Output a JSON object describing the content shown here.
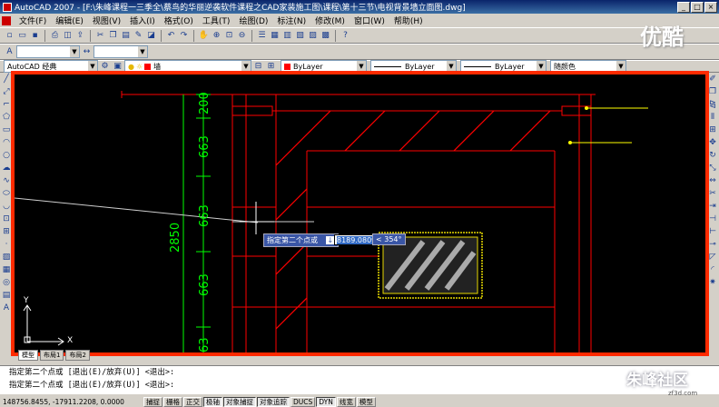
{
  "window": {
    "title": "AutoCAD 2007 - [F:\\朱峰课程一三季全\\蔡鸟的华丽逆袭软件课程之CAD家装施工图\\课程\\第十三节\\电视背景墙立面图.dwg]",
    "min": "_",
    "max": "□",
    "close": "×"
  },
  "menu": [
    "文件(F)",
    "编辑(E)",
    "视图(V)",
    "插入(I)",
    "格式(O)",
    "工具(T)",
    "绘图(D)",
    "标注(N)",
    "修改(M)",
    "窗口(W)",
    "帮助(H)"
  ],
  "toolbar": {
    "workspace": "AutoCAD 经典",
    "layer": "墙",
    "color": "ByLayer",
    "linetype": "ByLayer",
    "lineweight": "ByLayer",
    "plotstyle": "随颜色"
  },
  "drawing": {
    "dim_200": "200",
    "dim_663a": "663",
    "dim_663b": "663",
    "dim_663c": "663",
    "dim_63": "63",
    "dim_total": "2850",
    "ucs_y": "Y",
    "ucs_x": "X"
  },
  "dynamic_input": {
    "prompt": "指定第二个点或",
    "prompt_icon": "↓",
    "distance": "8189.0809",
    "angle": "< 354°"
  },
  "tabs": [
    "模型",
    "布局1",
    "布局2"
  ],
  "command": {
    "line1": "指定第二个点或 [退出(E)/放弃(U)] <退出>:",
    "line2": "指定第二个点或 [退出(E)/放弃(U)] <退出>:"
  },
  "status": {
    "coords": "148756.8455, -17911.2208, 0.0000",
    "buttons": [
      "捕捉",
      "栅格",
      "正交",
      "极轴",
      "对象捕捉",
      "对象追踪",
      "DUCS",
      "DYN",
      "线宽",
      "模型"
    ]
  },
  "watermark": {
    "top": "优酷",
    "bottom": "朱峰社区",
    "url": "zf3d.com"
  },
  "colors": {
    "frame": "#ff2a00",
    "lines": "#ff0000",
    "dims": "#00ff00"
  }
}
